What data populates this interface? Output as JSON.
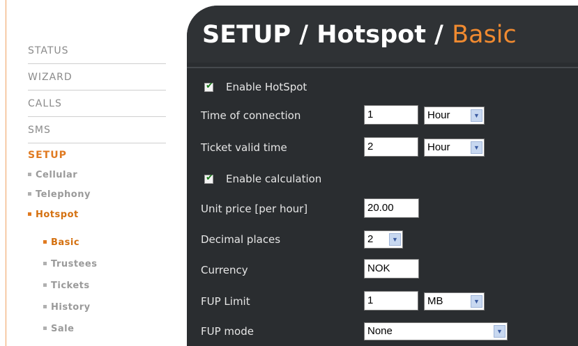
{
  "sidebar": {
    "items": [
      {
        "label": "STATUS"
      },
      {
        "label": "WIZARD"
      },
      {
        "label": "CALLS"
      },
      {
        "label": "SMS"
      },
      {
        "label": "SETUP"
      }
    ],
    "sub_items": [
      {
        "label": "Cellular"
      },
      {
        "label": "Telephony"
      },
      {
        "label": "Hotspot"
      }
    ],
    "hotspot_items": [
      {
        "label": "Basic"
      },
      {
        "label": "Trustees"
      },
      {
        "label": "Tickets"
      },
      {
        "label": "History"
      },
      {
        "label": "Sale"
      }
    ]
  },
  "header": {
    "title_main": "SETUP / Hotspot / ",
    "title_accent": "Basic"
  },
  "form": {
    "enable_hotspot": {
      "label": "Enable HotSpot",
      "checked": true
    },
    "time_of_connection": {
      "label": "Time of connection",
      "value": "1",
      "unit": "Hour"
    },
    "ticket_valid_time": {
      "label": "Ticket valid time",
      "value": "2",
      "unit": "Hour"
    },
    "enable_calculation": {
      "label": "Enable calculation",
      "checked": true
    },
    "unit_price": {
      "label": "Unit price [per hour]",
      "value": "20.00"
    },
    "decimal_places": {
      "label": "Decimal places",
      "value": "2"
    },
    "currency": {
      "label": "Currency",
      "value": "NOK"
    },
    "fup_limit": {
      "label": "FUP Limit",
      "value": "1",
      "unit": "MB"
    },
    "fup_mode": {
      "label": "FUP mode",
      "value": "None"
    }
  },
  "colors": {
    "accent": "#f08a30",
    "panel": "#2a2d30",
    "nav_inactive": "#8a8a8a"
  },
  "icons": {
    "checkbox": "checkmark-icon",
    "dropdown": "chevron-down-icon"
  }
}
